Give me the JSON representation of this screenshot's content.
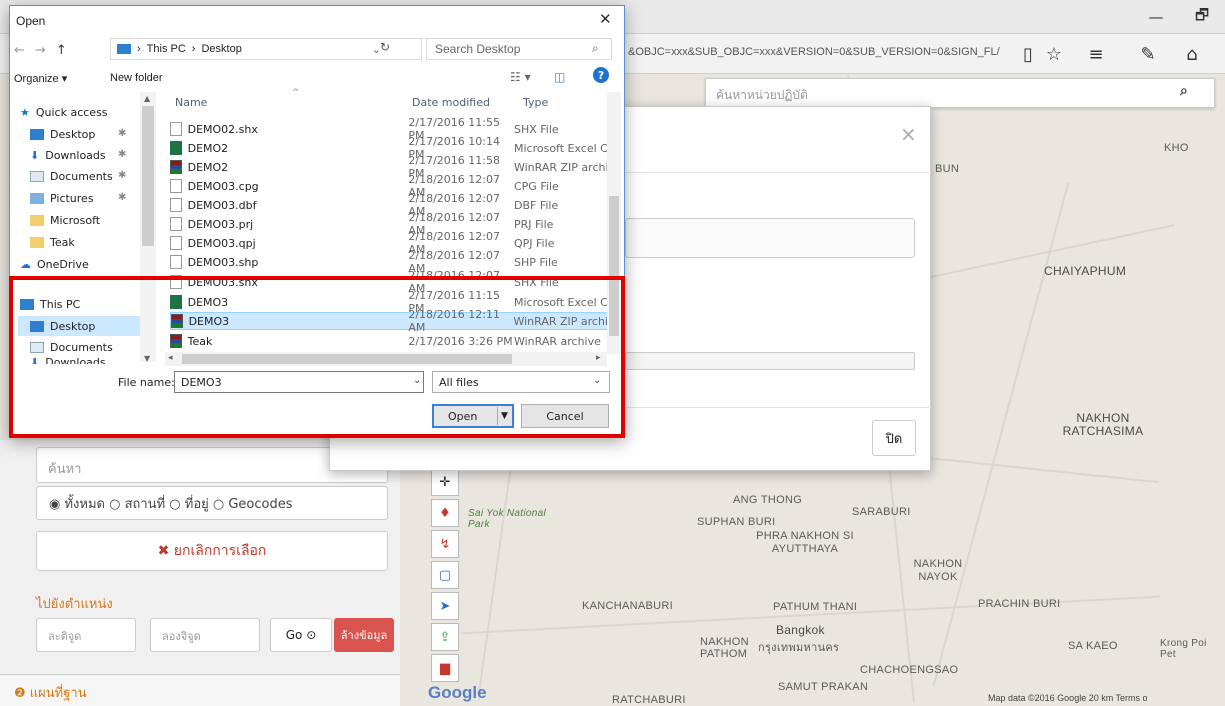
{
  "browser": {
    "url": "&OBJC=xxx&SUB_OBJC=xxx&VERSION=0&SUB_VERSION=0&SIGN_FL/",
    "minimize": "—",
    "restore": "🗗",
    "icons": [
      "reader-icon",
      "favorite-star-icon",
      "hub-icon",
      "web-note-icon",
      "share-icon"
    ]
  },
  "map": {
    "search_placeholder": "ค้นหาหน่วยปฏิบัติ",
    "labels": [
      {
        "text": "CHAIYAPHUM"
      },
      {
        "text": "NAKHON RATCHASIMA"
      },
      {
        "text": "ANG THONG"
      },
      {
        "text": "SARABURI"
      },
      {
        "text": "SUPHAN BURI"
      },
      {
        "text": "PHRA NAKHON SI AYUTTHAYA"
      },
      {
        "text": "NAKHON NAYOK"
      },
      {
        "text": "KANCHANABURI"
      },
      {
        "text": "PATHUM THANI"
      },
      {
        "text": "PRACHIN BURI"
      },
      {
        "text": "Bangkok"
      },
      {
        "text": "กรุงเทพมหานคร"
      },
      {
        "text": "NAKHON PATHOM"
      },
      {
        "text": "SA KAEO"
      },
      {
        "text": "CHACHOENGSAO"
      },
      {
        "text": "SAMUT PRAKAN"
      },
      {
        "text": "RATCHABURI"
      },
      {
        "text": "KHO"
      },
      {
        "text": "BUN"
      },
      {
        "text": "Sai Yok National Park"
      },
      {
        "text": "Krong Poi Pet"
      }
    ],
    "google_logo": "Google",
    "attribution": "Map data ©2016 Google   20 km        Terms o"
  },
  "left_panel": {
    "search_placeholder": "ค้นหา",
    "radio_options": "◉ ทั้งหมด ○ สถานที่ ○ ที่อยู่ ○ Geocodes",
    "cancel_selection": "✖ ยกเลิกการเลือก",
    "goto_label": "ไปยังตำแหน่ง",
    "lat_placeholder": "ละติจูด",
    "lng_placeholder": "ลองจิจูด",
    "go_button": "Go ⊙",
    "clear_button": "ล้างข้อมูล",
    "basemap": "❷ แผนที่ฐาน"
  },
  "modal": {
    "close_icon": "×",
    "close_button": "ปิด"
  },
  "dialog": {
    "title": "Open",
    "close": "✕",
    "breadcrumb": [
      "This PC",
      "Desktop"
    ],
    "search_placeholder": "Search Desktop",
    "organize": "Organize ▾",
    "new_folder": "New folder",
    "nav_items": [
      {
        "label": "Quick access"
      },
      {
        "label": "Desktop"
      },
      {
        "label": "Downloads"
      },
      {
        "label": "Documents"
      },
      {
        "label": "Pictures"
      },
      {
        "label": "Microsoft"
      },
      {
        "label": "Teak"
      },
      {
        "label": "OneDrive"
      },
      {
        "label": "This PC"
      },
      {
        "label": "Desktop"
      },
      {
        "label": "Documents"
      },
      {
        "label": "Downloads"
      }
    ],
    "columns": {
      "name": "Name",
      "date": "Date modified",
      "type": "Type"
    },
    "files": [
      {
        "name": "DEMO02.shx",
        "date": "2/17/2016 11:55 PM",
        "type": "SHX File",
        "icon": "generic"
      },
      {
        "name": "DEMO2",
        "date": "2/17/2016 10:14 PM",
        "type": "Microsoft Excel C",
        "icon": "excel"
      },
      {
        "name": "DEMO2",
        "date": "2/17/2016 11:58 PM",
        "type": "WinRAR ZIP archi",
        "icon": "rar"
      },
      {
        "name": "DEMO03.cpg",
        "date": "2/18/2016 12:07 AM",
        "type": "CPG File",
        "icon": "generic"
      },
      {
        "name": "DEMO03.dbf",
        "date": "2/18/2016 12:07 AM",
        "type": "DBF File",
        "icon": "generic"
      },
      {
        "name": "DEMO03.prj",
        "date": "2/18/2016 12:07 AM",
        "type": "PRJ File",
        "icon": "generic"
      },
      {
        "name": "DEMO03.qpj",
        "date": "2/18/2016 12:07 AM",
        "type": "QPJ File",
        "icon": "generic"
      },
      {
        "name": "DEMO03.shp",
        "date": "2/18/2016 12:07 AM",
        "type": "SHP File",
        "icon": "generic"
      },
      {
        "name": "DEMO03.shx",
        "date": "2/18/2016 12:07 AM",
        "type": "SHX File",
        "icon": "generic"
      },
      {
        "name": "DEMO3",
        "date": "2/17/2016 11:15 PM",
        "type": "Microsoft Excel C",
        "icon": "excel"
      },
      {
        "name": "DEMO3",
        "date": "2/18/2016 12:11 AM",
        "type": "WinRAR ZIP archi",
        "icon": "rar"
      },
      {
        "name": "Teak",
        "date": "2/17/2016 3:26 PM",
        "type": "WinRAR archive",
        "icon": "rar"
      }
    ],
    "file_name_label": "File name:",
    "file_name_value": "DEMO3",
    "file_type": "All files",
    "open_button": "Open",
    "cancel_button": "Cancel"
  }
}
